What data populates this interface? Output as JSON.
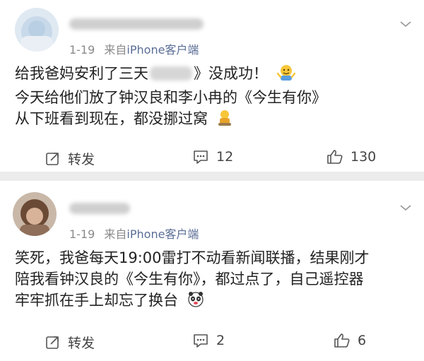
{
  "posts": [
    {
      "time": "1-19",
      "source_prefix": "来自",
      "source": "iPhone客户端",
      "lines": [
        {
          "before": "给我爸妈安利了三天",
          "after": "》没成功！"
        },
        {
          "text": "今天给他们放了钟汉良和李小冉的《今生有你》"
        },
        {
          "text": "从下班看到现在，都没挪过窝"
        }
      ],
      "actions": {
        "repost": "转发",
        "comments": "12",
        "likes": "130"
      }
    },
    {
      "time": "1-19",
      "source_prefix": "来自",
      "source": "iPhone客户端",
      "lines": [
        {
          "text": "笑死，我爸每天19:00雷打不动看新闻联播，结果刚才"
        },
        {
          "text": "陪我看钟汉良的《今生有你》，都过点了，自己遥控器"
        },
        {
          "text": "牢牢抓在手上却忘了换台"
        }
      ],
      "actions": {
        "repost": "转发",
        "comments": "2",
        "likes": "6"
      }
    }
  ],
  "icons": {
    "repost": "repost-icon",
    "comment": "comment-icon",
    "like": "like-icon",
    "more": "chevron-down-icon"
  },
  "colors": {
    "source_link": "#5a6d96",
    "meta": "#8a8a8a",
    "separator": "#ececec"
  }
}
